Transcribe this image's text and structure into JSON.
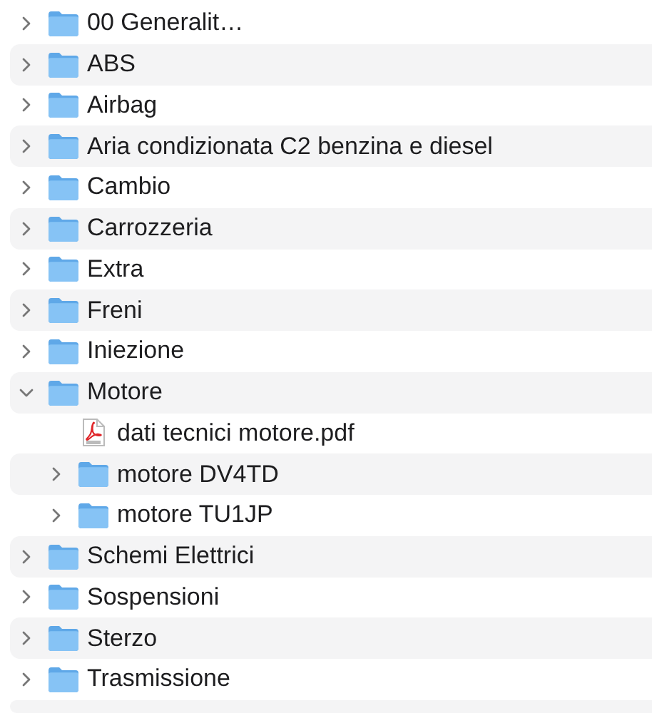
{
  "items": [
    {
      "kind": "folder",
      "name": "00 Generalit…",
      "expanded": false
    },
    {
      "kind": "folder",
      "name": "ABS",
      "expanded": false
    },
    {
      "kind": "folder",
      "name": "Airbag",
      "expanded": false
    },
    {
      "kind": "folder",
      "name": "Aria condizionata C2 benzina e diesel",
      "expanded": false
    },
    {
      "kind": "folder",
      "name": "Cambio",
      "expanded": false
    },
    {
      "kind": "folder",
      "name": "Carrozzeria",
      "expanded": false
    },
    {
      "kind": "folder",
      "name": "Extra",
      "expanded": false
    },
    {
      "kind": "folder",
      "name": "Freni",
      "expanded": false
    },
    {
      "kind": "folder",
      "name": "Iniezione",
      "expanded": false
    },
    {
      "kind": "folder",
      "name": "Motore",
      "expanded": true,
      "children": [
        {
          "kind": "pdf",
          "name": "dati tecnici motore.pdf"
        },
        {
          "kind": "folder",
          "name": "motore DV4TD",
          "expanded": false
        },
        {
          "kind": "folder",
          "name": "motore TU1JP",
          "expanded": false
        }
      ]
    },
    {
      "kind": "folder",
      "name": "Schemi Elettrici",
      "expanded": false
    },
    {
      "kind": "folder",
      "name": "Sospensioni",
      "expanded": false
    },
    {
      "kind": "folder",
      "name": "Sterzo",
      "expanded": false
    },
    {
      "kind": "folder",
      "name": "Trasmissione",
      "expanded": false
    }
  ]
}
